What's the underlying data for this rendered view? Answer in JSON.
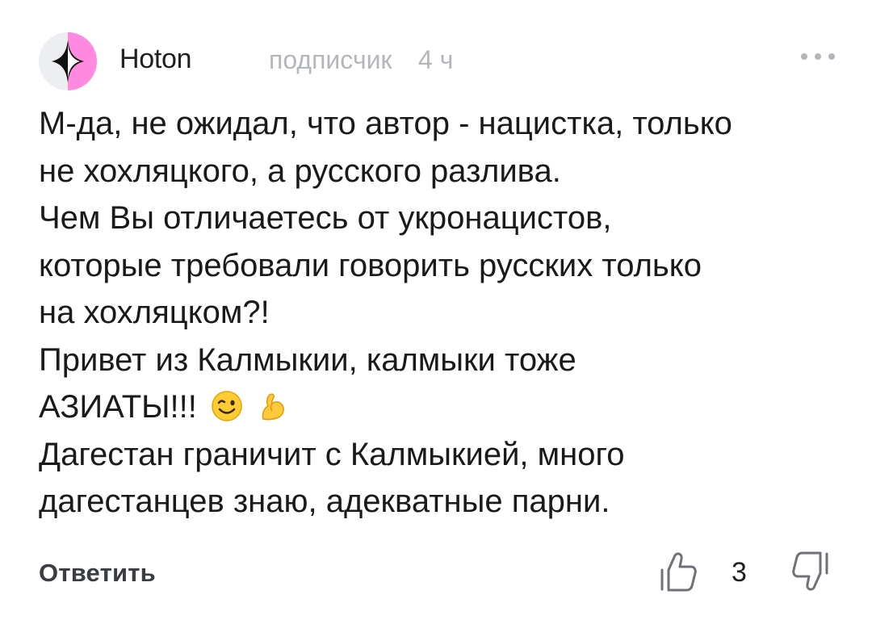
{
  "comment": {
    "author": "Hoton",
    "author_role": "подписчик",
    "time": "4 ч",
    "lines": [
      "М-да, не ожидал, что автор - нацистка, только",
      "не хохляцкого, а русского разлива.",
      "Чем Вы отличаетесь от укронацистов,",
      "которые требовали говорить русских только",
      "на хохляцком?!",
      "Привет из Калмыкии, калмыки тоже",
      "АЗИАТЫ!!!",
      "Дагестан граничит с Калмыкией, много",
      "дагестанцев знаю, адекватные парни."
    ],
    "emojis": [
      "winking-face-emoji",
      "flexed-biceps-emoji"
    ]
  },
  "actions": {
    "reply_label": "Ответить",
    "like_count": "3",
    "icons": [
      "more-dots-icon",
      "thumbs-up-icon",
      "thumbs-down-icon"
    ]
  },
  "colors": {
    "text": "#1a1a1a",
    "muted": "#b3b6bb",
    "avatar_bg": "#eceef1",
    "avatar_accent": "#ff8ae0"
  }
}
